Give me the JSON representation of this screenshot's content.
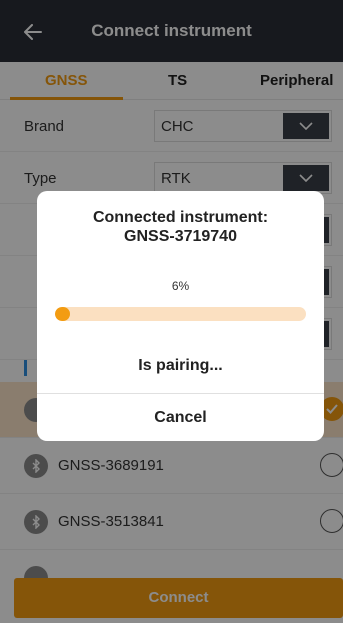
{
  "header": {
    "title": "Connect instrument"
  },
  "tabs": [
    {
      "label": "GNSS",
      "active": true
    },
    {
      "label": "TS",
      "active": false
    },
    {
      "label": "Peripheral",
      "active": false
    }
  ],
  "form": {
    "brand": {
      "label": "Brand",
      "value": "CHC"
    },
    "type": {
      "label": "Type",
      "value": "RTK"
    }
  },
  "devices": [
    {
      "name": "GNSS-3689191",
      "selected": false
    },
    {
      "name": "GNSS-3513841",
      "selected": false
    }
  ],
  "connect_button": "Connect",
  "dialog": {
    "title_line1": "Connected instrument:",
    "title_line2": "GNSS-3719740",
    "progress_text": "6%",
    "progress_fraction": 0.06,
    "status": "Is pairing...",
    "cancel_label": "Cancel"
  },
  "colors": {
    "accent": "#f39c12",
    "appbar": "#2b2f38",
    "link": "#2f8fe0"
  },
  "icons": {
    "back": "arrow-left-icon",
    "dropdown": "chevron-down-icon",
    "device": "bluetooth-icon",
    "check": "check-icon"
  }
}
